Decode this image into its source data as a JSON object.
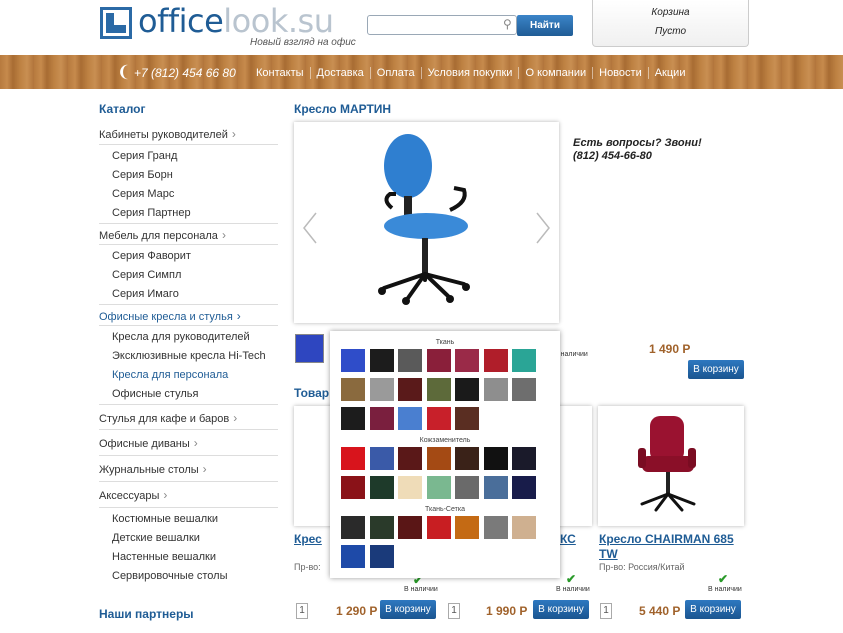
{
  "header": {
    "logo_part1": "office",
    "logo_part2": "look.su",
    "tagline": "Новый взгляд на офис",
    "search_placeholder": "",
    "search_button": "Найти",
    "cart_title": "Корзина",
    "cart_status": "Пусто"
  },
  "topbar": {
    "phone": "+7 (812) 454 66 80",
    "nav": [
      "Контакты",
      "Доставка",
      "Оплата",
      "Условия покупки",
      "О компании",
      "Новости",
      "Акции"
    ]
  },
  "sidebar": {
    "title": "Каталог",
    "categories": [
      {
        "label": "Кабинеты руководителей",
        "subs": [
          "Серия Гранд",
          "Серия Борн",
          "Серия Марс",
          "Серия Партнер"
        ]
      },
      {
        "label": "Мебель для персонала",
        "subs": [
          "Серия Фаворит",
          "Серия Симпл",
          "Серия Имаго"
        ]
      },
      {
        "label": "Офисные кресла и стулья",
        "subs": [
          "Кресла для руководителей",
          "Эксклюзивные кресла Hi-Tech",
          "Кресла для персонала",
          "Офисные стулья"
        ]
      },
      {
        "label": "Стулья для кафе и баров",
        "subs": []
      },
      {
        "label": "Офисные диваны",
        "subs": []
      },
      {
        "label": "Журнальные столы",
        "subs": []
      },
      {
        "label": "Аксессуары",
        "subs": [
          "Костюмные вешалки",
          "Детские вешалки",
          "Настенные вешалки",
          "Сервировочные столы"
        ]
      }
    ],
    "partners_title": "Наши партнеры"
  },
  "product": {
    "title": "Кресло МАРТИН",
    "question_line1": "Есть вопросы? Звони!",
    "question_line2": "(812) 454-66-80",
    "price": "1 490 Р",
    "buy_button": "В корзину",
    "stock_label": "В наличии"
  },
  "related": {
    "section_title": "Товар",
    "cards": [
      {
        "name": "Крес",
        "origin": "Пр-во:",
        "price": "1 290 Р",
        "qty": "1",
        "stock": "В наличии",
        "buy": "В корзину"
      },
      {
        "name": "КС",
        "origin": "",
        "price": "1 990 Р",
        "qty": "1",
        "stock": "В наличии",
        "buy": "В корзину"
      },
      {
        "name": "Кресло CHAIRMAN 685 TW",
        "name_line1": "Кресло CHAIRMAN 685",
        "name_line2": "TW",
        "origin": "Пр-во: Россия/Китай",
        "price": "5 440 Р",
        "qty": "1",
        "stock": "В наличии",
        "buy": "В корзину"
      }
    ]
  },
  "color_popup": {
    "groups": [
      {
        "label": "Ткань",
        "colors": [
          "#2f4dc9",
          "#1c1c1c",
          "#5a5a5a",
          "#8a1f3a",
          "#9a2a48",
          "#b01e2a",
          "#2aa596",
          "#8a6a3e",
          "#9a9a9a",
          "#5a1a1a",
          "#5d6a3a",
          "#1a1a1a",
          "#8e8e8e",
          "#6e6e6e",
          "#1c1c1c",
          "#7a1f3e",
          "#4a7fd0",
          "#c8202a",
          "#5a2e22"
        ]
      },
      {
        "label": "Кожзаменитель",
        "colors": [
          "#d8141c",
          "#3a5aa8",
          "#5a1818",
          "#a44a14",
          "#3a2218",
          "#111111",
          "#1a1a2a",
          "#8a1218",
          "#1e3a2a",
          "#efdcb8",
          "#7ab890",
          "#6a6a6a",
          "#4a6e9a",
          "#181c4a"
        ]
      },
      {
        "label": "Ткань-Сетка",
        "colors": [
          "#2a2a2a",
          "#2a3a2a",
          "#5a1616",
          "#c81e22",
          "#c46a14",
          "#7a7a7a",
          "#cfb090",
          "#1e4aa8",
          "#1a3a7a"
        ]
      }
    ]
  }
}
